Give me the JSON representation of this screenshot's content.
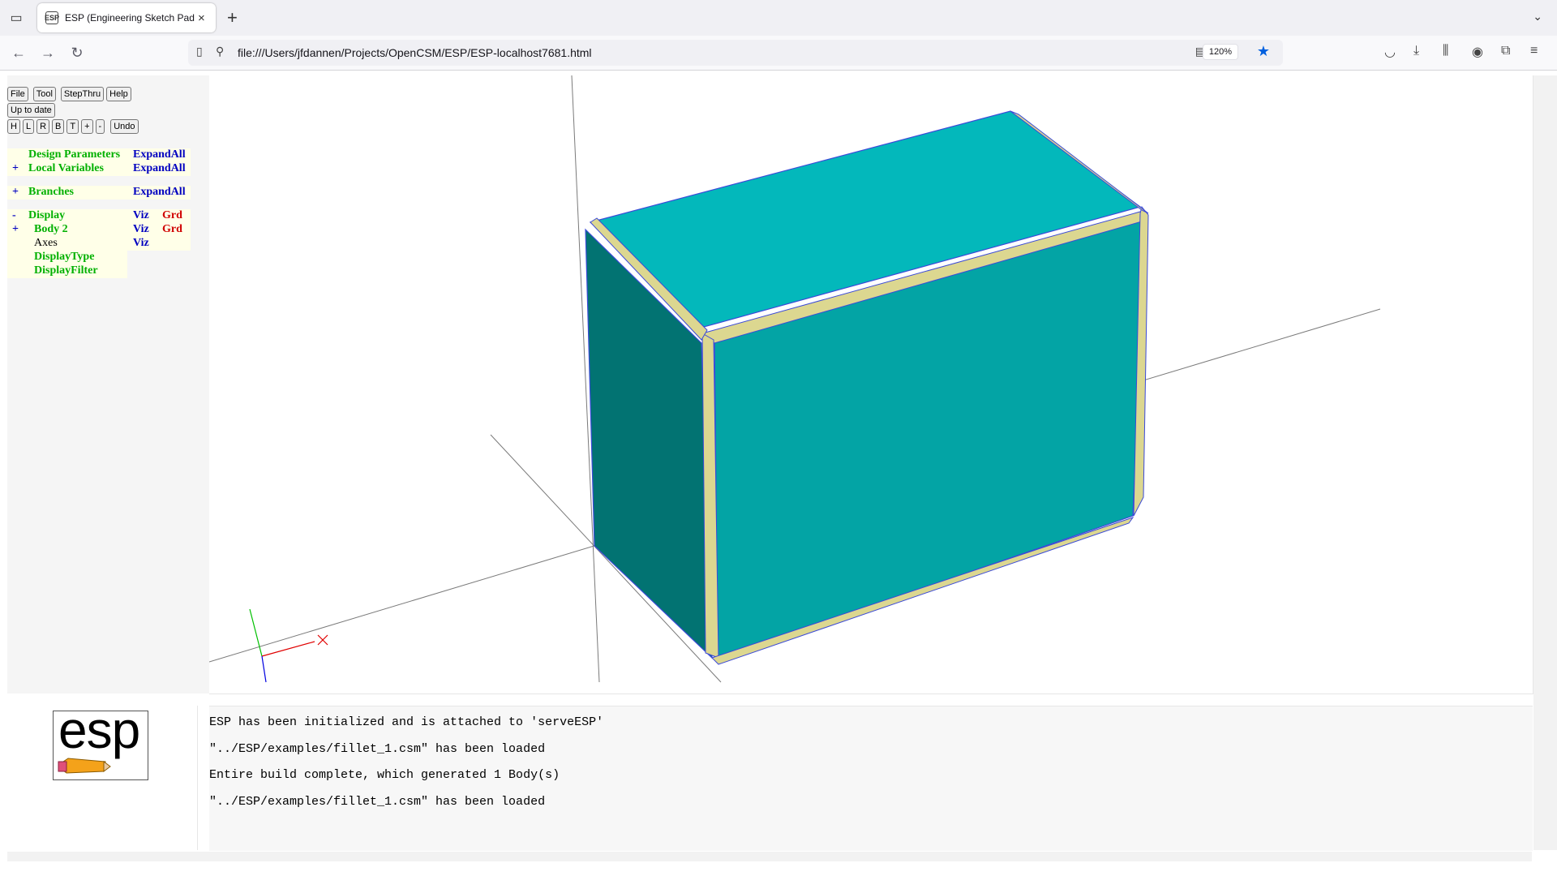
{
  "browser": {
    "tab_title": "ESP (Engineering Sketch Pad, V",
    "favicon_text": "ESP",
    "url": "file:///Users/jfdannen/Projects/OpenCSM/ESP/ESP-localhost7681.html",
    "zoom": "120%",
    "new_tab": "+",
    "close": "×"
  },
  "toolbar": {
    "row1": [
      "File",
      "Tool",
      "StepThru",
      "Help"
    ],
    "status": "Up to date",
    "row3": [
      "H",
      "L",
      "R",
      "B",
      "T",
      "+",
      "-",
      "Undo"
    ]
  },
  "tree": {
    "design_params": {
      "toggle": "",
      "label": "Design Parameters",
      "action": "ExpandAll"
    },
    "local_vars": {
      "toggle": "+",
      "label": "Local Variables",
      "action": "ExpandAll"
    },
    "branches": {
      "toggle": "+",
      "label": "Branches",
      "action": "ExpandAll"
    },
    "display": {
      "toggle": "-",
      "label": "Display",
      "viz": "Viz",
      "grd": "Grd"
    },
    "body2": {
      "toggle": "+",
      "label": "Body 2",
      "viz": "Viz",
      "grd": "Grd"
    },
    "axes": {
      "label": "Axes",
      "viz": "Viz"
    },
    "display_type": {
      "label": "DisplayType"
    },
    "display_filter": {
      "label": "DisplayFilter"
    }
  },
  "logo": {
    "text": "esp"
  },
  "messages": [
    "ESP has been initialized and is attached to 'serveESP'",
    "\"../ESP/examples/fillet_1.csm\" has been loaded",
    "Entire build complete, which generated 1 Body(s)",
    "\"../ESP/examples/fillet_1.csm\" has been loaded"
  ],
  "colors": {
    "face_top": "#03b8bb",
    "face_front": "#03a4a5",
    "face_left": "#027372",
    "fillet": "#dcd790",
    "edge": "#3b4ad8",
    "tree_green": "#00b000",
    "tree_blue": "#0000c0",
    "tree_red": "#d00000",
    "accent": "#0060df"
  }
}
